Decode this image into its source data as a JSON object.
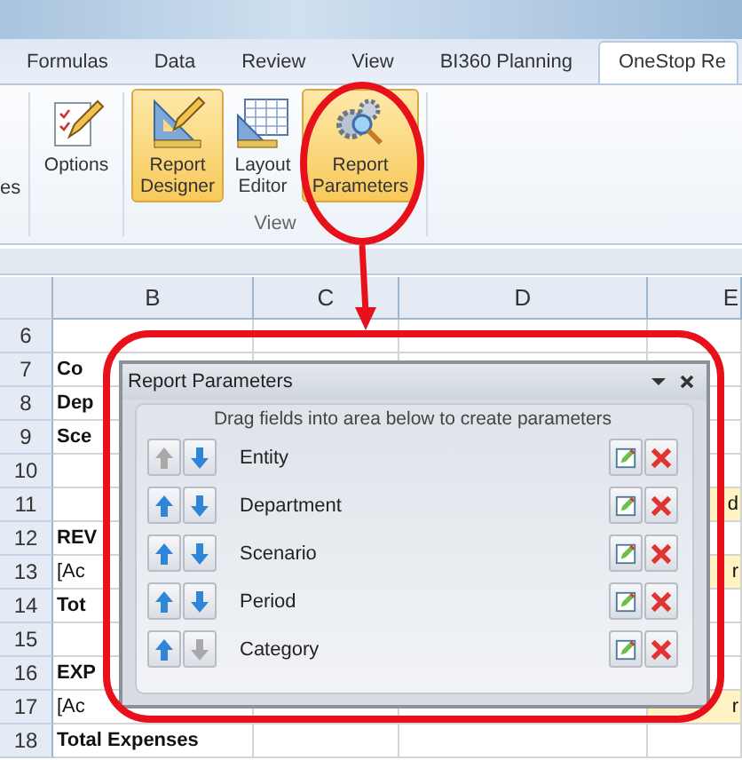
{
  "ribbon_tabs": [
    {
      "label": "Formulas",
      "selected": false
    },
    {
      "label": "Data",
      "selected": false
    },
    {
      "label": "Review",
      "selected": false
    },
    {
      "label": "View",
      "selected": false
    },
    {
      "label": "BI360 Planning",
      "selected": false
    },
    {
      "label": "OneStop Re",
      "selected": true
    }
  ],
  "ribbon": {
    "cut_label": "es",
    "options_button": {
      "label": "Options",
      "kind": "options",
      "highlighted": false
    },
    "view_group": {
      "label": "View",
      "buttons": [
        {
          "label": "Report Designer",
          "kind": "designer",
          "highlighted": true
        },
        {
          "label": "Layout Editor",
          "kind": "layout",
          "highlighted": false
        },
        {
          "label": "Report Parameters",
          "kind": "parameters",
          "highlighted": true
        }
      ]
    }
  },
  "sheet": {
    "columns": [
      "B",
      "C",
      "D",
      "E"
    ],
    "rows": [
      {
        "number": "6"
      },
      {
        "number": "7",
        "column_b": "Co",
        "bold": true
      },
      {
        "number": "8",
        "column_b": "Dep",
        "bold": true
      },
      {
        "number": "9",
        "column_b": "Sce",
        "bold": true
      },
      {
        "number": "10"
      },
      {
        "number": "11",
        "column_e": "d"
      },
      {
        "number": "12",
        "column_b": "REV",
        "bold": true
      },
      {
        "number": "13",
        "column_b": "[Ac",
        "bold": false,
        "column_e": "r"
      },
      {
        "number": "14",
        "column_b": "Tot",
        "bold": true
      },
      {
        "number": "15"
      },
      {
        "number": "16",
        "column_b": "EXP",
        "bold": true
      },
      {
        "number": "17",
        "column_b": "[Ac",
        "bold": false,
        "column_e": "r"
      },
      {
        "number": "18",
        "column_b": "Total Expenses",
        "bold": true
      }
    ]
  },
  "panel": {
    "title": "Report Parameters",
    "hint": "Drag fields into area below to create parameters",
    "fields": [
      {
        "name": "Entity",
        "up_enabled": false,
        "down_enabled": true
      },
      {
        "name": "Department",
        "up_enabled": true,
        "down_enabled": true
      },
      {
        "name": "Scenario",
        "up_enabled": true,
        "down_enabled": true
      },
      {
        "name": "Period",
        "up_enabled": true,
        "down_enabled": true
      },
      {
        "name": "Category",
        "up_enabled": true,
        "down_enabled": false
      }
    ]
  }
}
